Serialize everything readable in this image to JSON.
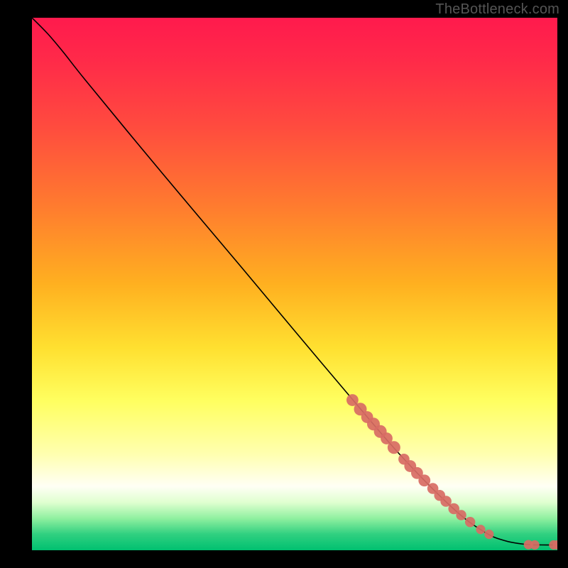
{
  "watermark": "TheBottleneck.com",
  "colors": {
    "bg_black": "#000000",
    "curve": "#000000",
    "dot_fill": "#d86b64",
    "dot_stroke": "#b9564f"
  },
  "chart_data": {
    "type": "line",
    "title": "",
    "xlabel": "",
    "ylabel": "",
    "xlim": [
      0,
      100
    ],
    "ylim": [
      0,
      100
    ],
    "gradient_stops": [
      {
        "offset": 0.0,
        "color": "#ff1a4d"
      },
      {
        "offset": 0.08,
        "color": "#ff2a49"
      },
      {
        "offset": 0.2,
        "color": "#ff4a3f"
      },
      {
        "offset": 0.35,
        "color": "#ff7a2f"
      },
      {
        "offset": 0.5,
        "color": "#ffb020"
      },
      {
        "offset": 0.62,
        "color": "#ffe030"
      },
      {
        "offset": 0.72,
        "color": "#ffff60"
      },
      {
        "offset": 0.82,
        "color": "#ffffb0"
      },
      {
        "offset": 0.88,
        "color": "#fffff5"
      },
      {
        "offset": 0.91,
        "color": "#e0ffd0"
      },
      {
        "offset": 0.94,
        "color": "#90f0a0"
      },
      {
        "offset": 0.97,
        "color": "#30d080"
      },
      {
        "offset": 1.0,
        "color": "#00c070"
      }
    ],
    "curve": [
      {
        "x": 0,
        "y": 100
      },
      {
        "x": 3,
        "y": 97
      },
      {
        "x": 6,
        "y": 93.5
      },
      {
        "x": 10,
        "y": 88.5
      },
      {
        "x": 20,
        "y": 76.5
      },
      {
        "x": 30,
        "y": 64.7
      },
      {
        "x": 40,
        "y": 53.0
      },
      {
        "x": 50,
        "y": 41.2
      },
      {
        "x": 60,
        "y": 29.5
      },
      {
        "x": 70,
        "y": 18.0
      },
      {
        "x": 80,
        "y": 8.0
      },
      {
        "x": 86,
        "y": 3.5
      },
      {
        "x": 90,
        "y": 1.8
      },
      {
        "x": 94,
        "y": 1.1
      },
      {
        "x": 97,
        "y": 1.0
      },
      {
        "x": 100,
        "y": 1.0
      }
    ],
    "dots": [
      {
        "x": 61.0,
        "y": 28.2,
        "r": 1.4
      },
      {
        "x": 62.5,
        "y": 26.5,
        "r": 1.5
      },
      {
        "x": 63.8,
        "y": 25.0,
        "r": 1.4
      },
      {
        "x": 65.0,
        "y": 23.7,
        "r": 1.5
      },
      {
        "x": 66.3,
        "y": 22.3,
        "r": 1.5
      },
      {
        "x": 67.5,
        "y": 21.0,
        "r": 1.4
      },
      {
        "x": 68.9,
        "y": 19.3,
        "r": 1.5
      },
      {
        "x": 70.8,
        "y": 17.1,
        "r": 1.3
      },
      {
        "x": 72.0,
        "y": 15.8,
        "r": 1.4
      },
      {
        "x": 73.3,
        "y": 14.5,
        "r": 1.4
      },
      {
        "x": 74.7,
        "y": 13.1,
        "r": 1.4
      },
      {
        "x": 76.3,
        "y": 11.6,
        "r": 1.3
      },
      {
        "x": 77.6,
        "y": 10.3,
        "r": 1.3
      },
      {
        "x": 78.8,
        "y": 9.2,
        "r": 1.3
      },
      {
        "x": 80.3,
        "y": 7.8,
        "r": 1.3
      },
      {
        "x": 81.7,
        "y": 6.6,
        "r": 1.2
      },
      {
        "x": 83.4,
        "y": 5.3,
        "r": 1.2
      },
      {
        "x": 85.4,
        "y": 3.9,
        "r": 1.1
      },
      {
        "x": 87.0,
        "y": 3.0,
        "r": 1.1
      },
      {
        "x": 94.5,
        "y": 1.05,
        "r": 1.1
      },
      {
        "x": 95.7,
        "y": 1.0,
        "r": 1.1
      },
      {
        "x": 99.3,
        "y": 1.0,
        "r": 1.1
      },
      {
        "x": 100.0,
        "y": 1.0,
        "r": 1.1
      }
    ]
  }
}
